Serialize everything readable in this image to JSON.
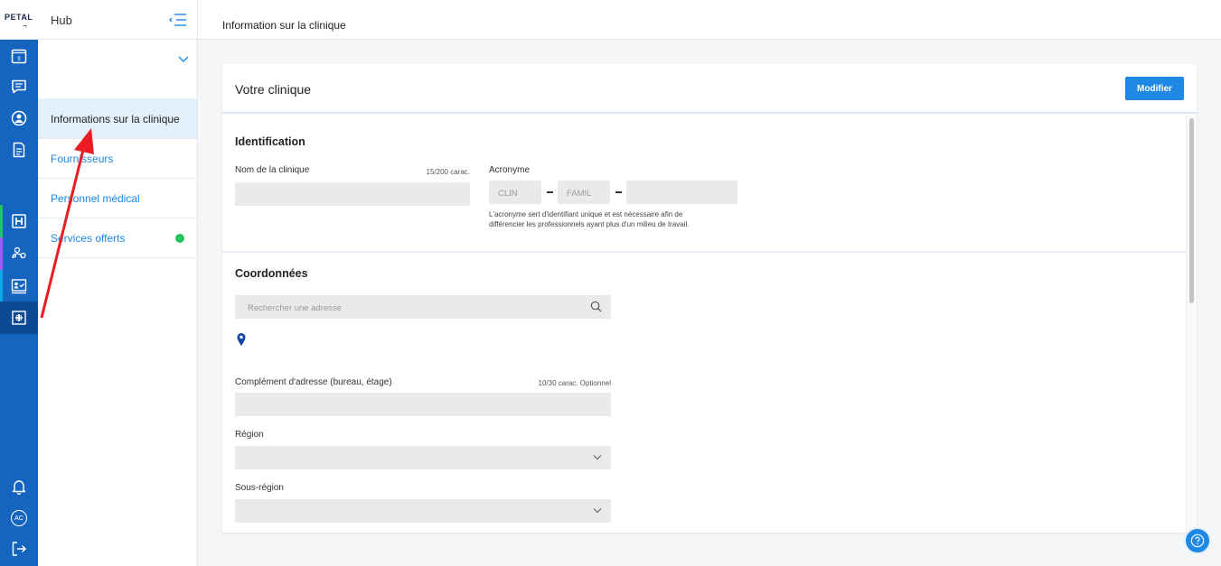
{
  "app": {
    "logo": "PETAL",
    "logo_mark": "¬",
    "title": "Hub"
  },
  "topbar": {
    "title": "Information sur la clinique"
  },
  "sidebar": {
    "items": [
      {
        "label": "Informations sur la clinique",
        "active": true
      },
      {
        "label": "Fournisseurs"
      },
      {
        "label": "Personnel médical"
      },
      {
        "label": "Services offerts",
        "status_dot": true
      }
    ]
  },
  "rail": {
    "calendar_day": "9",
    "icons": [
      "calendar-icon",
      "chat-icon",
      "user-circle-icon",
      "document-icon",
      "hospital-icon",
      "team-icon",
      "patient-board-icon",
      "clinic-icon"
    ],
    "bottom_icons": [
      "bell-icon",
      "avatar",
      "logout-icon"
    ],
    "avatar_initials": "AC",
    "accent_colors": [
      "#22c55e",
      "#a855f7",
      "#0ea5e9"
    ]
  },
  "card": {
    "title": "Votre clinique",
    "edit_button": "Modifier",
    "identification": {
      "title": "Identification",
      "name_label": "Nom de la clinique",
      "name_counter": "15/200 carac.",
      "acronym_label": "Acronyme",
      "acronym_part1": "CLIN",
      "acronym_part2": "FAMIL",
      "acronym_hint_1": "L'acronyme sert d'identifiant unique et est nécessaire afin de",
      "acronym_hint_2": "différencier les professionnels ayant plus d'un milieu de travail."
    },
    "coordinates": {
      "title": "Coordonnées",
      "search_placeholder": "Rechercher une adresse",
      "complement_label": "Complément d'adresse (bureau, étage)",
      "complement_counter": "10/30 carac. Optionnel",
      "region_label": "Région",
      "subregion_label": "Sous-région"
    }
  },
  "help": {
    "icon": "help-icon"
  },
  "colors": {
    "primary": "#1e88e5",
    "rail": "#1565c0",
    "status_ok": "#22c55e"
  }
}
